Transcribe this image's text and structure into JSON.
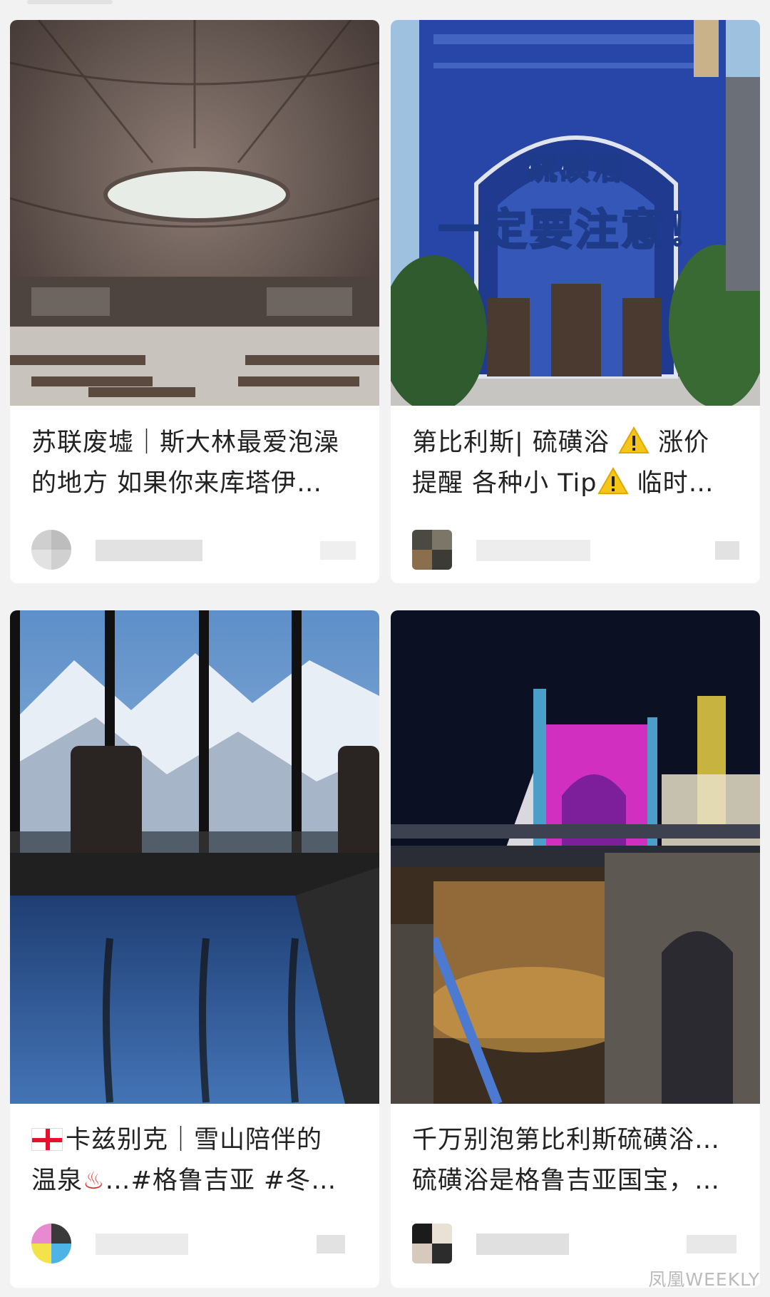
{
  "feed": {
    "cards": [
      {
        "title_line1": "苏联废墟｜斯大林最爱泡澡",
        "title_line2": "的地方 如果你来库塔伊…",
        "thumb_icon": "soviet-ruins-photo"
      },
      {
        "title_line1_a": "第比利斯| 硫磺浴 ",
        "title_line1_b": " 涨价",
        "title_line2_a": "提醒 各种小 Tip",
        "title_line2_b": " 临时…",
        "overlay_line1": "硫磺浴",
        "overlay_line2": "一定要注意！",
        "thumb_icon": "mosque-bathhouse-photo"
      },
      {
        "title_line1": "卡兹别克｜雪山陪伴的",
        "title_line2_a": "温泉",
        "title_line2_b": "…#格鲁吉亚 #冬…",
        "thumb_icon": "mountain-pool-photo"
      },
      {
        "title_line1": "千万别泡第比利斯硫磺浴…",
        "title_line2": "硫磺浴是格鲁吉亚国宝，…",
        "thumb_icon": "tbilisi-night-photo"
      }
    ]
  },
  "hotspring_glyph": "♨",
  "watermark": "凤凰WEEKLY",
  "colors": {
    "warning": "#f5c518",
    "flag_red": "#e8112d",
    "mosque_blue": "#2746a8",
    "night_magenta": "#d02fc0"
  }
}
